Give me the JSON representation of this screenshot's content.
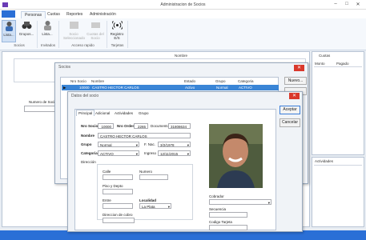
{
  "window": {
    "title": "Administracion de Socios"
  },
  "ribbon_tabs": {
    "personas": "Personas",
    "cuotas": "Cuotas",
    "reportes": "Reportes",
    "administracion": "Administración"
  },
  "ribbon": {
    "lista_socios": "Lista...",
    "grupos": "Grupos...",
    "lista_invitados": "Lista...",
    "socio_seleccionado": "Socio Seleccionado",
    "cuotas_socio": "Cuotas del Socio",
    "registro_es": "Registro E/S",
    "groups": {
      "socios": "Socios",
      "invitados": "Invitados",
      "acceso_rapido": "Acceso rapido",
      "tarjetas": "Tarjetas"
    }
  },
  "background": {
    "nombre_header": "Nombre",
    "numero_socio_label": "Numero de Socio"
  },
  "cuotas_panel": {
    "title": "Cuotas",
    "col_monto": "Monto",
    "col_pagado": "Pagado"
  },
  "actividades_panel": {
    "title": "Actividades"
  },
  "socios_window": {
    "title": "Socios",
    "columns": [
      "Nro Socio",
      "Nombre",
      "Estado",
      "Grupo",
      "Categoria"
    ],
    "row": {
      "nro": "10000",
      "nombre": "CASTRO HECTOR CARLOS",
      "estado": "Activo",
      "grupo": "Normal",
      "categoria": "ACTIVO"
    },
    "nuevo_button": "Nuevo..."
  },
  "datos_window": {
    "title": "Datos del socio",
    "tabs": [
      "Principal",
      "Adicional",
      "Actividades",
      "Grupo"
    ],
    "nro_socio_label": "Nro Socio",
    "nro_socio": "10000",
    "nro_orden_label": "Nro Orden",
    "nro_orden": "2265",
    "documento_label": "Documento",
    "documento": "31808634",
    "nombre_label": "Nombre",
    "nombre": "CASTRO HECTOR CARLOS",
    "grupo_label": "Grupo",
    "grupo": "Normal",
    "f_nac_label": "F. Nac.",
    "f_nac": "3/2/1978",
    "categoria_label": "Categoria",
    "categoria": "ACTIVO",
    "ingreso_label": "Ingreso",
    "ingreso": "12/11/2015",
    "direccion_label": "Dirección",
    "calle_label": "Calle",
    "numero_label": "Numero",
    "piso_label": "Piso y Depto",
    "entre_label": "Entre",
    "localidad_label": "Localidad",
    "localidad": "La Plata",
    "cobro_label": "Direccion de cobro",
    "cobrador_label": "Cobrador",
    "secuencia_label": "Secuencia",
    "tarjeta_label": "Codigo Tarjeta",
    "aceptar": "Aceptar",
    "cancelar": "Cancelar"
  }
}
